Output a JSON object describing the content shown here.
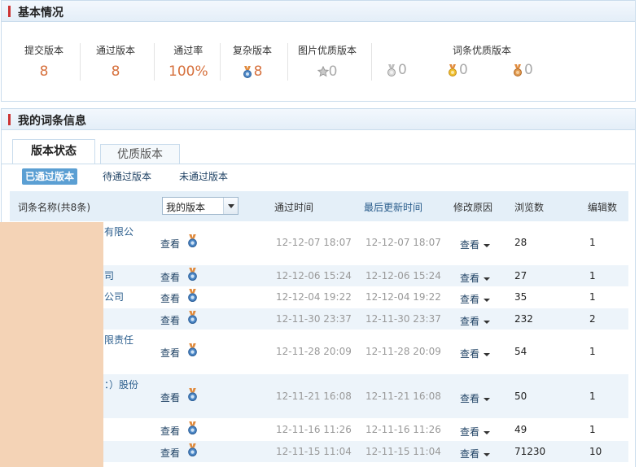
{
  "basic": {
    "title": "基本情况",
    "stats": [
      {
        "label": "提交版本",
        "value": "8"
      },
      {
        "label": "通过版本",
        "value": "8"
      },
      {
        "label": "通过率",
        "value": "100%"
      },
      {
        "label": "复杂版本",
        "value": "8",
        "icon": "blue-medal-icon"
      },
      {
        "label": "图片优质版本",
        "value": "0",
        "icon": "grey-star-medal-icon"
      }
    ],
    "quality_label": "词条优质版本",
    "quality_values": [
      {
        "value": "0",
        "icon": "silver-medal-icon"
      },
      {
        "value": "0",
        "icon": "gold-medal-icon"
      },
      {
        "value": "0",
        "icon": "bronze-medal-icon"
      }
    ]
  },
  "entries": {
    "title": "我的词条信息",
    "tabs": [
      "版本状态",
      "优质版本"
    ],
    "subtabs": [
      "已通过版本",
      "待通过版本",
      "未通过版本"
    ],
    "columns": {
      "name": "词条名称(共8条)",
      "my_version": "我的版本",
      "pass_time": "通过时间",
      "last_update": "最后更新时间",
      "reason": "修改原因",
      "views": "浏览数",
      "edits": "编辑数"
    },
    "view_label": "查看",
    "rows": [
      {
        "name": "有限公",
        "pass": "12-12-07 18:07",
        "update": "12-12-07 18:07",
        "views": "28",
        "edits": "1"
      },
      {
        "name": "司",
        "pass": "12-12-06 15:24",
        "update": "12-12-06 15:24",
        "views": "27",
        "edits": "1"
      },
      {
        "name": "公司",
        "pass": "12-12-04 19:22",
        "update": "12-12-04 19:22",
        "views": "35",
        "edits": "1"
      },
      {
        "name": "",
        "pass": "12-11-30 23:37",
        "update": "12-11-30 23:37",
        "views": "232",
        "edits": "2"
      },
      {
        "name": "限责任",
        "pass": "12-11-28 20:09",
        "update": "12-11-28 20:09",
        "views": "54",
        "edits": "1"
      },
      {
        "name": "：）股份",
        "pass": "12-11-21 16:08",
        "update": "12-11-21 16:08",
        "views": "50",
        "edits": "1"
      },
      {
        "name": "",
        "pass": "12-11-16 11:26",
        "update": "12-11-16 11:26",
        "views": "49",
        "edits": "1"
      },
      {
        "name": "",
        "pass": "12-11-15 11:04",
        "update": "12-11-15 11:04",
        "views": "71230",
        "edits": "10"
      }
    ],
    "reason_label": "查看"
  },
  "colors": {
    "accent": "#d6703c",
    "link": "#2a5d8c",
    "header_bg": "#e4eff8",
    "alt_row": "#edf4fa"
  }
}
